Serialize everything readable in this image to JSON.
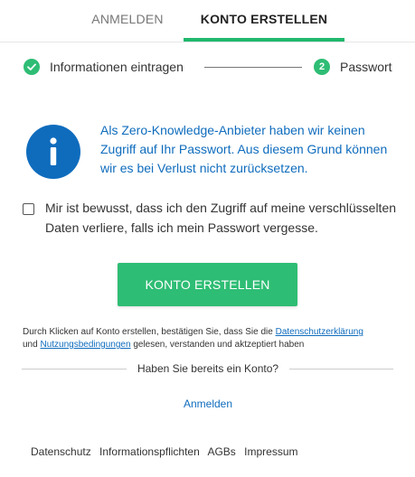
{
  "tabs": {
    "login": "ANMELDEN",
    "register": "KONTO ERSTELLEN"
  },
  "stepper": {
    "step1": {
      "label": "Informationen eintragen",
      "status": "completed",
      "icon": "check-icon"
    },
    "step2": {
      "label": "Passwort",
      "number": "2",
      "status": "active"
    }
  },
  "info": {
    "icon": "info-icon",
    "text": "Als Zero-Knowledge-Anbieter haben wir keinen Zugriff auf Ihr Passwort. Aus diesem Grund können wir es bei Verlust nicht zurücksetzen."
  },
  "consent": {
    "checked": false,
    "label": "Mir ist bewusst, dass ich den Zugriff auf meine verschlüsselten Daten verliere, falls ich mein Passwort vergesse."
  },
  "submit_label": "KONTO ERSTELLEN",
  "legal": {
    "part1": "Durch Klicken auf Konto erstellen, bestätigen Sie, dass Sie die ",
    "privacy_link": "Datenschutzerklärung",
    "part2": " und ",
    "terms_link": "Nutzungsbedingungen",
    "part3": " gelesen, verstanden und aktzeptiert haben"
  },
  "divider_text": "Haben Sie bereits ein Konto?",
  "login_link": "Anmelden",
  "footer": {
    "links": [
      "Datenschutz",
      "Informationspflichten",
      "AGBs",
      "Impressum"
    ]
  },
  "colors": {
    "accent_green": "#2ebd74",
    "info_blue": "#0f6cbd"
  }
}
